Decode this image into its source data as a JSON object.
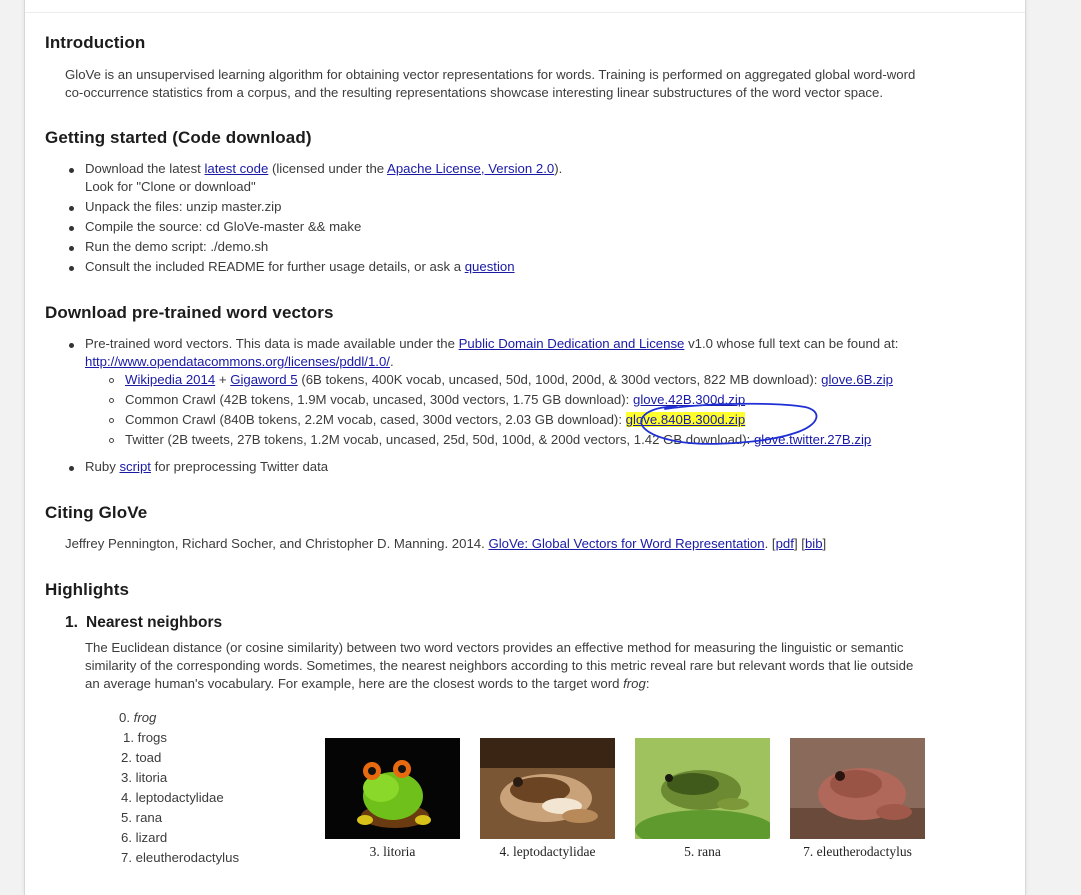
{
  "introduction": {
    "heading": "Introduction",
    "line1": "GloVe is an unsupervised learning algorithm for obtaining vector representations for words. Training is performed on aggregated global word-word",
    "line2": "co-occurrence statistics from a corpus, and the resulting representations showcase interesting linear substructures of the word vector space."
  },
  "getting_started": {
    "heading": "Getting started (Code download)",
    "item1_pre": "Download the latest ",
    "item1_link": "latest code",
    "item1_mid": " (licensed under the ",
    "item1_link2": "Apache License, Version 2.0",
    "item1_post": ").",
    "item1_line2": "Look for \"Clone or download\"",
    "item2": "Unpack the files: unzip master.zip",
    "item3": "Compile the source: cd GloVe-master && make",
    "item4": "Run the demo script: ./demo.sh",
    "item5_pre": "Consult the included README for further usage details, or ask a ",
    "item5_link": "question"
  },
  "download": {
    "heading": "Download pre-trained word vectors",
    "item1_pre": "Pre-trained word vectors. This data is made available under the ",
    "item1_link": "Public Domain Dedication and License",
    "item1_post": " v1.0 whose full text can be found at:",
    "item1_url": "http://www.opendatacommons.org/licenses/pddl/1.0/",
    "item1_url_post": ".",
    "sub1_link_a": "Wikipedia 2014",
    "sub1_plus": " + ",
    "sub1_link_b": "Gigaword 5",
    "sub1_text": " (6B tokens, 400K vocab, uncased, 50d, 100d, 200d, & 300d vectors, 822 MB download): ",
    "sub1_file": "glove.6B.zip",
    "sub2_text": "Common Crawl (42B tokens, 1.9M vocab, uncased, 300d vectors, 1.75 GB download): ",
    "sub2_file": "glove.42B.300d.zip",
    "sub3_text": "Common Crawl (840B tokens, 2.2M vocab, cased, 300d vectors, 2.03 GB download): ",
    "sub3_file": "glove.840B.300d.zip",
    "sub4_text": "Twitter (2B tweets, 27B tokens, 1.2M vocab, uncased, 25d, 50d, 100d, & 200d vectors, 1.42 GB download): ",
    "sub4_file": "glove.twitter.27B.zip",
    "item2_pre": "Ruby ",
    "item2_link": "script",
    "item2_post": " for preprocessing Twitter data",
    "highlight_color": "#ffff2c",
    "annotation_color": "#1f2fd6"
  },
  "citing": {
    "heading": "Citing GloVe",
    "text": "Jeffrey Pennington, Richard Socher, and Christopher D. Manning. 2014. ",
    "paper_link": "GloVe: Global Vectors for Word Representation",
    "sep": ". [",
    "pdf_link": "pdf",
    "sep2": "] [",
    "bib_link": "bib",
    "end": "]"
  },
  "highlights": {
    "heading": "Highlights",
    "sub_number": "1.",
    "sub_heading": "Nearest neighbors",
    "line1": "The Euclidean distance (or cosine similarity) between two word vectors provides an effective method for measuring the linguistic or semantic",
    "line2": "similarity of the corresponding words. Sometimes, the nearest neighbors according to this metric reveal rare but relevant words that lie outside",
    "line3_pre": "an average human's vocabulary. For example, here are the closest words to the target word ",
    "line3_word": "frog",
    "line3_post": ":",
    "neighbors": [
      {
        "n": "0.",
        "w": "frog"
      },
      {
        "n": "1.",
        "w": "frogs"
      },
      {
        "n": "2.",
        "w": "toad"
      },
      {
        "n": "3.",
        "w": "litoria"
      },
      {
        "n": "4.",
        "w": "leptodactylidae"
      },
      {
        "n": "5.",
        "w": "rana"
      },
      {
        "n": "6.",
        "w": "lizard"
      },
      {
        "n": "7.",
        "w": "eleutherodactylus"
      }
    ],
    "captions": [
      "3. litoria",
      "4. leptodactylidae",
      "5. rana",
      "7. eleutherodactylus"
    ]
  }
}
